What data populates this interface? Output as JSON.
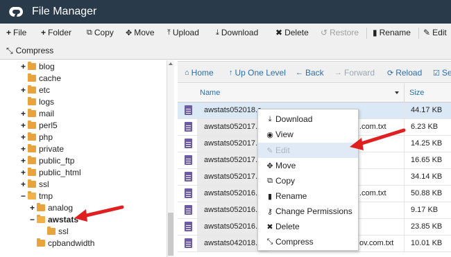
{
  "app": {
    "title": "File Manager",
    "logo_icon": "cpanel-logo-icon"
  },
  "toolbar": {
    "buttons": [
      {
        "label": "File",
        "icon": "plus-icon"
      },
      {
        "label": "Folder",
        "icon": "plus-icon"
      },
      {
        "label": "Copy",
        "icon": "copy-icon"
      },
      {
        "label": "Move",
        "icon": "move-icon"
      },
      {
        "label": "Upload",
        "icon": "upload-icon"
      },
      {
        "label": "Download",
        "icon": "download-icon"
      },
      {
        "label": "Delete",
        "icon": "delete-icon"
      },
      {
        "label": "Restore",
        "icon": "restore-icon",
        "disabled": true
      },
      {
        "label": "Rename",
        "icon": "rename-icon"
      },
      {
        "label": "Edit",
        "icon": "edit-icon"
      },
      {
        "label": "Compress",
        "icon": "compress-icon"
      }
    ]
  },
  "tree": {
    "items": [
      {
        "label": "blog",
        "expander": "+"
      },
      {
        "label": "cache",
        "expander": ""
      },
      {
        "label": "etc",
        "expander": "+"
      },
      {
        "label": "logs",
        "expander": ""
      },
      {
        "label": "mail",
        "expander": "+"
      },
      {
        "label": "perl5",
        "expander": "+"
      },
      {
        "label": "php",
        "expander": "+"
      },
      {
        "label": "private",
        "expander": "+"
      },
      {
        "label": "public_ftp",
        "expander": "+"
      },
      {
        "label": "public_html",
        "expander": "+"
      },
      {
        "label": "ssl",
        "expander": "+"
      },
      {
        "label": "tmp",
        "expander": "−"
      },
      {
        "label": "analog",
        "expander": "+"
      },
      {
        "label": "awstats",
        "expander": "−",
        "selected": true
      },
      {
        "label": "ssl",
        "expander": ""
      },
      {
        "label": "cpbandwidth",
        "expander": ""
      }
    ]
  },
  "nav": {
    "home": "Home",
    "up_one_level": "Up One Level",
    "back": "Back",
    "forward": "Forward",
    "reload": "Reload",
    "select": "Se"
  },
  "table": {
    "col_name": "Name",
    "col_size": "Size",
    "rows": [
      {
        "name": "awstats052018.a",
        "size": "44.17 KB",
        "selected": true
      },
      {
        "name": "awstats052017.",
        "name_tail": ".com.txt",
        "size": "6.23 KB"
      },
      {
        "name": "awstats052017.",
        "size": "14.25 KB"
      },
      {
        "name": "awstats052017.",
        "size": "16.65 KB"
      },
      {
        "name": "awstats052017.",
        "size": "34.14 KB"
      },
      {
        "name": "awstats052016.",
        "name_tail": ".com.txt",
        "size": "50.88 KB"
      },
      {
        "name": "awstats052016.",
        "size": "9.17 KB"
      },
      {
        "name": "awstats052016.",
        "size": "23.85 KB"
      },
      {
        "name": "awstats042018.s",
        "name_tail": "ov.com.txt",
        "size": "10.01 KB"
      }
    ]
  },
  "context_menu": {
    "items": [
      {
        "label": "Download",
        "icon": "download-icon"
      },
      {
        "label": "View",
        "icon": "eye-icon"
      },
      {
        "label": "Edit",
        "icon": "pencil-icon",
        "highlighted": true
      },
      {
        "label": "Move",
        "icon": "move-icon"
      },
      {
        "label": "Copy",
        "icon": "copy-icon"
      },
      {
        "label": "Rename",
        "icon": "rename-icon"
      },
      {
        "label": "Change Permissions",
        "icon": "key-icon"
      },
      {
        "label": "Delete",
        "icon": "delete-icon"
      },
      {
        "label": "Compress",
        "icon": "compress-icon"
      }
    ]
  },
  "colors": {
    "titlebar": "#293a4a",
    "link": "#2a6fb0",
    "arrow": "#e02020",
    "file_icon": "#6c5ba7",
    "folder": "#e8a33c"
  }
}
